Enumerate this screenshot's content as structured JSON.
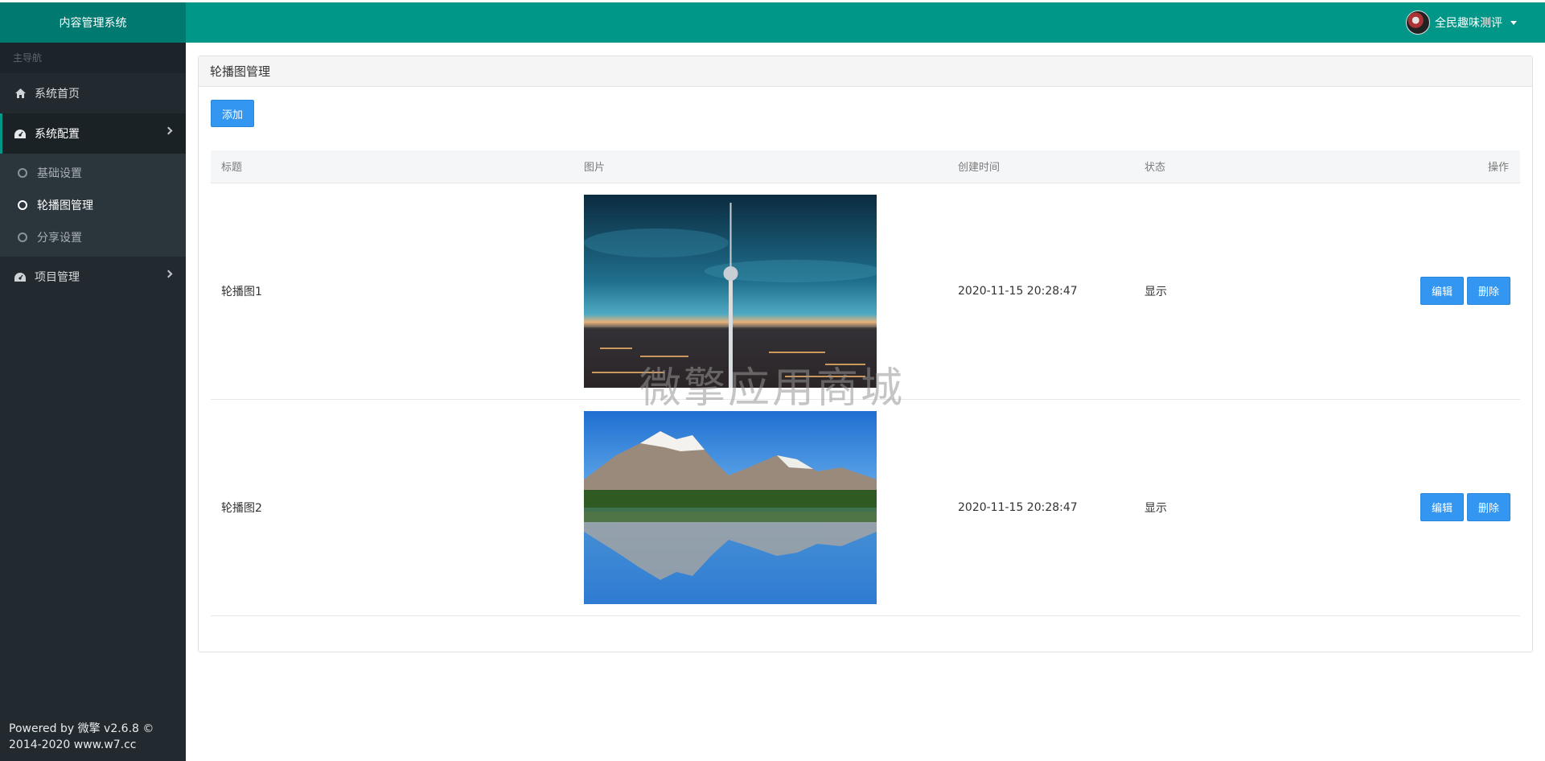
{
  "header": {
    "brand": "内容管理系统",
    "user_name": "全民趣味测评"
  },
  "sidebar": {
    "caption": "主导航",
    "items": [
      {
        "label": "系统首页",
        "icon": "home-icon"
      },
      {
        "label": "系统配置",
        "icon": "dashboard-icon"
      },
      {
        "label": "项目管理",
        "icon": "dashboard-icon"
      }
    ],
    "subitems": [
      {
        "label": "基础设置"
      },
      {
        "label": "轮播图管理"
      },
      {
        "label": "分享设置"
      }
    ],
    "footer_line1": "Powered by 微擎 v2.6.8 ©",
    "footer_line2": "2014-2020 www.w7.cc"
  },
  "main": {
    "panel_title": "轮播图管理",
    "add_label": "添加",
    "columns": [
      "标题",
      "图片",
      "创建时间",
      "状态",
      "操作"
    ],
    "rows": [
      {
        "title": "轮播图1",
        "image": "berlin-tv-tower-night-city",
        "created": "2020-11-15 20:28:47",
        "status": "显示",
        "edit": "编辑",
        "delete": "删除"
      },
      {
        "title": "轮播图2",
        "image": "mountain-lake-reflection",
        "created": "2020-11-15 20:28:47",
        "status": "显示",
        "edit": "编辑",
        "delete": "删除"
      }
    ],
    "watermark": "微擎应用商城"
  },
  "colors": {
    "teal": "#009688",
    "sidebar": "#222a30",
    "button": "#3396f0"
  }
}
